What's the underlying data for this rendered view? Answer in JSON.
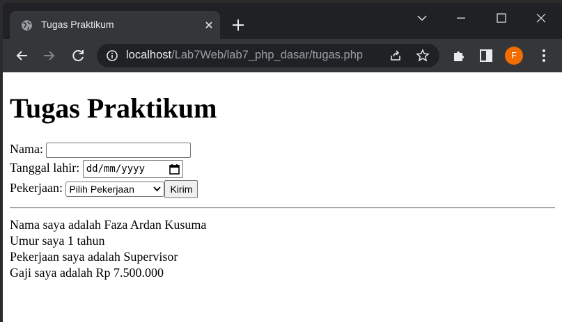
{
  "browser": {
    "tab_title": "Tugas Praktikum",
    "url_host": "localhost",
    "url_path": "/Lab7Web/lab7_php_dasar/tugas.php",
    "profile_initial": "F",
    "icons": [
      "globe-icon",
      "close-icon",
      "plus-icon",
      "chevron-down-icon",
      "minimize-icon",
      "maximize-icon",
      "window-close-icon",
      "back-icon",
      "forward-icon",
      "reload-icon",
      "info-icon",
      "share-icon",
      "star-icon",
      "puzzle-icon",
      "sidepanel-icon",
      "kebab-menu-icon"
    ],
    "accent_color": "#f36c00"
  },
  "page": {
    "heading": "Tugas Praktikum",
    "form": {
      "nama_label": "Nama:",
      "nama_value": "",
      "tanggal_label": "Tanggal lahir:",
      "tanggal_placeholder": "dd/mm/yyyy",
      "pekerjaan_label": "Pekerjaan:",
      "pekerjaan_selected": "Pilih Pekerjaan",
      "submit_label": "Kirim"
    },
    "result": [
      "Nama saya adalah Faza Ardan Kusuma",
      "Umur saya 1 tahun",
      "Pekerjaan saya adalah Supervisor",
      "Gaji saya adalah Rp 7.500.000"
    ]
  }
}
